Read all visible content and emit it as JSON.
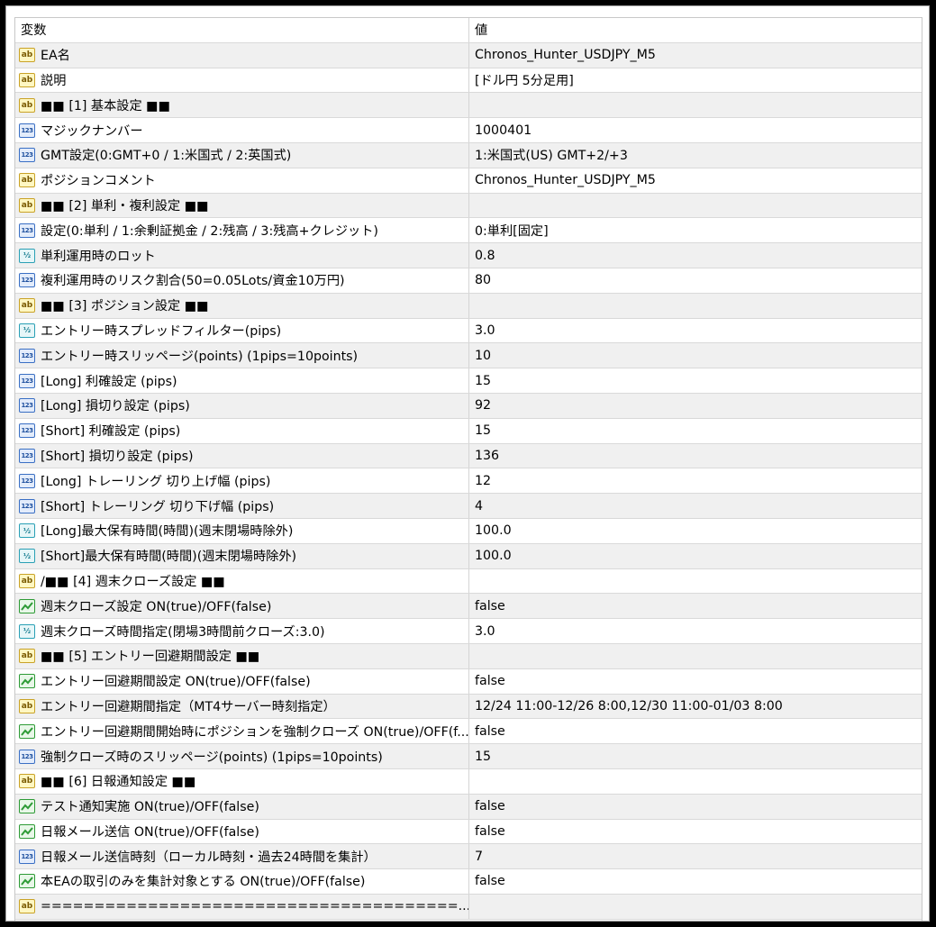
{
  "header": {
    "name": "変数",
    "value": "値"
  },
  "rows": [
    {
      "type": "ab",
      "name": "EA名",
      "value": "Chronos_Hunter_USDJPY_M5"
    },
    {
      "type": "ab",
      "name": "説明",
      "value": "[ドル円 5分足用]"
    },
    {
      "type": "ab",
      "name": "■■ [1] 基本設定 ■■",
      "value": ""
    },
    {
      "type": "123",
      "name": "マジックナンバー",
      "value": "1000401"
    },
    {
      "type": "123",
      "name": "GMT設定(0:GMT+0 / 1:米国式 / 2:英国式)",
      "value": "1:米国式(US) GMT+2/+3"
    },
    {
      "type": "ab",
      "name": "ポジションコメント",
      "value": "Chronos_Hunter_USDJPY_M5"
    },
    {
      "type": "ab",
      "name": "■■ [2] 単利・複利設定 ■■",
      "value": ""
    },
    {
      "type": "123",
      "name": "設定(0:単利 / 1:余剰証拠金 / 2:残高 / 3:残高+クレジット)",
      "value": "0:単利[固定]"
    },
    {
      "type": "half",
      "name": "単利運用時のロット",
      "value": "0.8"
    },
    {
      "type": "123",
      "name": "複利運用時のリスク割合(50=0.05Lots/資金10万円)",
      "value": "80"
    },
    {
      "type": "ab",
      "name": "■■ [3] ポジション設定 ■■",
      "value": ""
    },
    {
      "type": "half",
      "name": "エントリー時スプレッドフィルター(pips)",
      "value": "3.0"
    },
    {
      "type": "123",
      "name": "エントリー時スリッページ(points) (1pips=10points)",
      "value": "10"
    },
    {
      "type": "123",
      "name": "[Long] 利確設定 (pips)",
      "value": "15"
    },
    {
      "type": "123",
      "name": "[Long] 損切り設定 (pips)",
      "value": "92"
    },
    {
      "type": "123",
      "name": "[Short] 利確設定 (pips)",
      "value": "15"
    },
    {
      "type": "123",
      "name": "[Short] 損切り設定 (pips)",
      "value": "136"
    },
    {
      "type": "123",
      "name": "[Long] トレーリング 切り上げ幅 (pips)",
      "value": "12"
    },
    {
      "type": "123",
      "name": "[Short] トレーリング 切り下げ幅 (pips)",
      "value": "4"
    },
    {
      "type": "half",
      "name": "[Long]最大保有時間(時間)(週末閉場時除外)",
      "value": "100.0"
    },
    {
      "type": "half",
      "name": "[Short]最大保有時間(時間)(週末閉場時除外)",
      "value": "100.0"
    },
    {
      "type": "ab",
      "name": "/■■ [4] 週末クローズ設定 ■■",
      "value": ""
    },
    {
      "type": "bool",
      "name": "週末クローズ設定 ON(true)/OFF(false)",
      "value": "false"
    },
    {
      "type": "half",
      "name": "週末クローズ時間指定(閉場3時間前クローズ:3.0)",
      "value": "3.0"
    },
    {
      "type": "ab",
      "name": "■■ [5] エントリー回避期間設定 ■■",
      "value": ""
    },
    {
      "type": "bool",
      "name": "エントリー回避期間設定 ON(true)/OFF(false)",
      "value": "false"
    },
    {
      "type": "ab",
      "name": "エントリー回避期間指定（MT4サーバー時刻指定）",
      "value": "12/24 11:00-12/26 8:00,12/30 11:00-01/03 8:00"
    },
    {
      "type": "bool",
      "name": "エントリー回避期間開始時にポジションを強制クローズ ON(true)/OFF(f...",
      "value": "false"
    },
    {
      "type": "123",
      "name": "強制クローズ時のスリッページ(points) (1pips=10points)",
      "value": "15"
    },
    {
      "type": "ab",
      "name": "■■ [6] 日報通知設定 ■■",
      "value": ""
    },
    {
      "type": "bool",
      "name": "テスト通知実施 ON(true)/OFF(false)",
      "value": "false"
    },
    {
      "type": "bool",
      "name": "日報メール送信 ON(true)/OFF(false)",
      "value": "false"
    },
    {
      "type": "123",
      "name": "日報メール送信時刻（ローカル時刻・過去24時間を集計）",
      "value": "7"
    },
    {
      "type": "bool",
      "name": "本EAの取引のみを集計対象とする ON(true)/OFF(false)",
      "value": "false"
    },
    {
      "type": "ab",
      "name": "=======================================...",
      "value": ""
    }
  ],
  "icon_names": {
    "ab": "string-type-icon",
    "123": "integer-type-icon",
    "half": "double-type-icon",
    "bool": "boolean-type-icon"
  },
  "icon_glyphs": {
    "ab": "ab",
    "123": "123",
    "half": "½"
  }
}
